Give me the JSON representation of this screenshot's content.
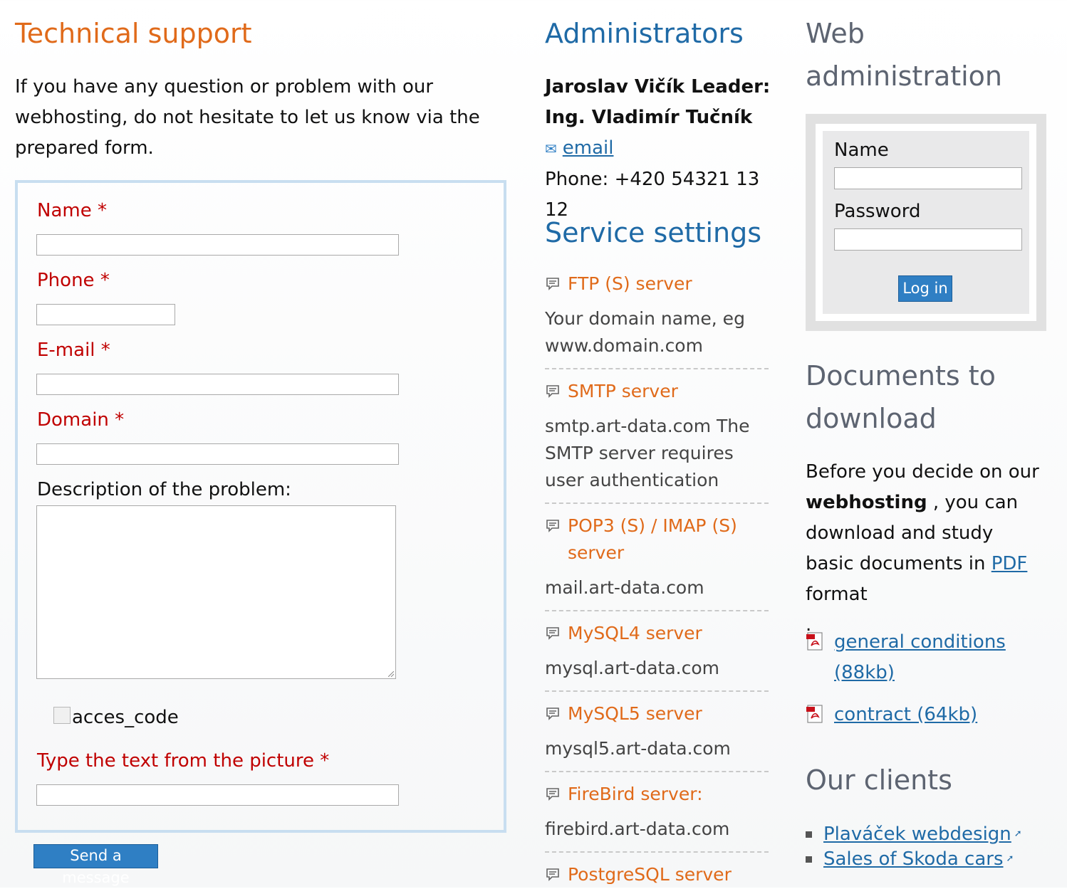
{
  "support": {
    "title": "Technical support",
    "intro": "If you have any question or problem with our webhosting, do not hesitate to let us know via the prepared form.",
    "fields": {
      "name_label": "Name",
      "phone_label": "Phone",
      "email_label": "E-mail",
      "domain_label": "Domain",
      "required_mark": "*",
      "description_label": "Description of the problem:",
      "captcha_alt": "acces_code",
      "captcha_label": "Type the text from the picture"
    },
    "send_button": "Send a message"
  },
  "admins": {
    "title": "Administrators",
    "line1": "Jaroslav Vičík Leader:",
    "line2": "Ing. Vladimír Tučník",
    "email_link": "email",
    "phone": "Phone: +420 54321 13 12"
  },
  "services": {
    "title": "Service settings",
    "items": [
      {
        "name": "FTP (S) server",
        "desc": "Your domain name, eg www.domain.com"
      },
      {
        "name": "SMTP server",
        "desc": "smtp.art-data.com The SMTP server requires user authentication"
      },
      {
        "name": "POP3 (S) / IMAP (S) server",
        "desc": "mail.art-data.com"
      },
      {
        "name": "MySQL4 server",
        "desc": "mysql.art-data.com"
      },
      {
        "name": "MySQL5 server",
        "desc": "mysql5.art-data.com"
      },
      {
        "name": "FireBird server:",
        "desc": "firebird.art-data.com"
      },
      {
        "name": "PostgreSQL server",
        "desc": ""
      }
    ]
  },
  "webadmin": {
    "title": "Web administration",
    "name_label": "Name",
    "password_label": "Password",
    "login_button": "Log in"
  },
  "documents": {
    "title": "Documents to download",
    "text_before": "Before you decide on our",
    "text_bold": "webhosting",
    "text_after": ", you can download and study basic documents in",
    "pdf_link": "PDF",
    "text_end": "format",
    "trailing_dot": ".",
    "files": [
      {
        "label": "general conditions (88kb)"
      },
      {
        "label": "contract (64kb)"
      }
    ]
  },
  "clients": {
    "title": "Our clients",
    "items": [
      {
        "label": "Plaváček webdesign"
      },
      {
        "label": "Sales of Skoda cars"
      }
    ]
  },
  "colors": {
    "orange": "#e06a1a",
    "blue": "#1f6aa6",
    "required_red": "#c00000",
    "button_blue": "#2f7fc4"
  }
}
